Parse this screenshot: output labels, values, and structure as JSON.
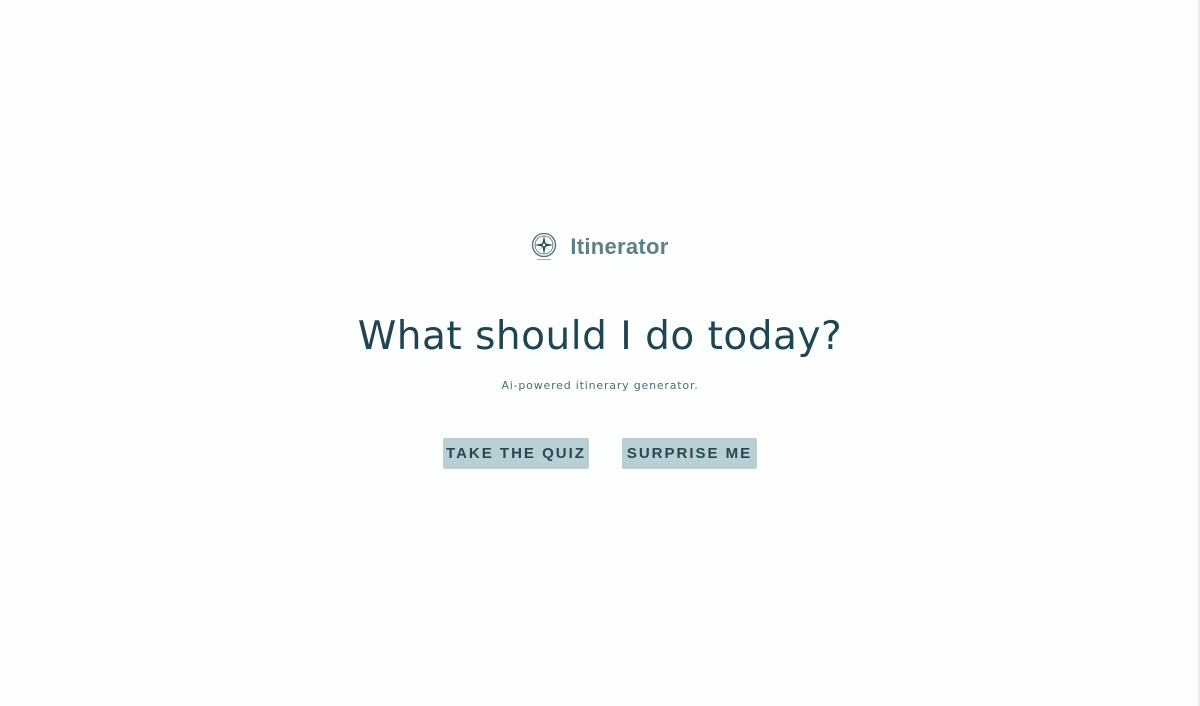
{
  "brand": {
    "name": "Itinerator",
    "logo_icon": "compass-icon",
    "color": "#5f7f85"
  },
  "hero": {
    "headline": "What should I do today?",
    "subtitle": "Ai-powered itinerary generator."
  },
  "actions": {
    "quiz_label": "TAKE THE QUIZ",
    "surprise_label": "SURPRISE ME",
    "button_color": "#b9cfd3"
  },
  "colors": {
    "headline": "#1f4554",
    "background": "#fdfefe"
  }
}
